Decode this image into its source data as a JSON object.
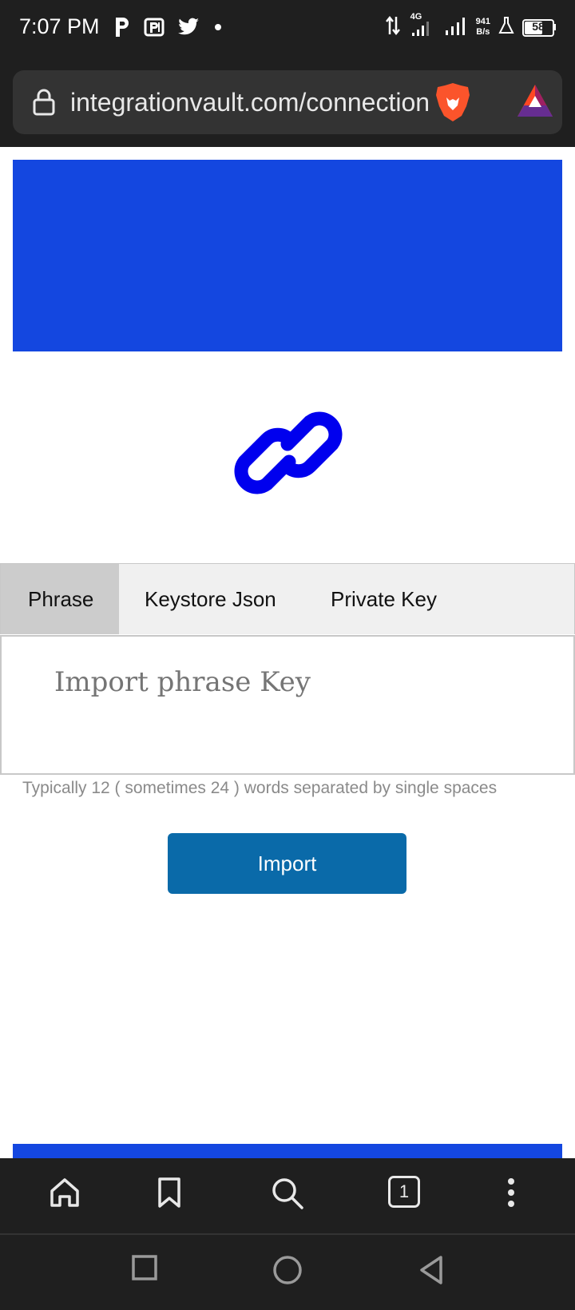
{
  "status_bar": {
    "time": "7:07 PM",
    "network_type": "4G",
    "speed_value": "941",
    "speed_unit": "B/s",
    "battery": "58",
    "icons": [
      "p-app-icon",
      "parking-icon",
      "twitter-icon",
      "dot-icon",
      "data-arrows-icon",
      "signal-icon",
      "signal-icon",
      "lab-icon",
      "battery-icon"
    ]
  },
  "browser": {
    "url": "integrationvault.com/connection",
    "icons": [
      "lock-icon",
      "brave-lion-icon",
      "bat-triangle-icon"
    ],
    "tab_count": "1"
  },
  "page": {
    "tabs": [
      {
        "label": "Phrase",
        "active": true
      },
      {
        "label": "Keystore Json",
        "active": false
      },
      {
        "label": "Private Key",
        "active": false
      }
    ],
    "input_placeholder": "Import phrase Key",
    "helper_text": "Typically 12 ( sometimes 24 ) words separated by single spaces",
    "import_label": "Import",
    "colors": {
      "hero": "#1447e0",
      "link_icon": "#0000ee",
      "button": "#0a6aa9"
    }
  },
  "bottom_nav": [
    "home-icon",
    "bookmark-icon",
    "search-icon",
    "tabs-icon",
    "more-icon"
  ],
  "system_nav": [
    "recents-icon",
    "home-circle-icon",
    "back-icon"
  ]
}
